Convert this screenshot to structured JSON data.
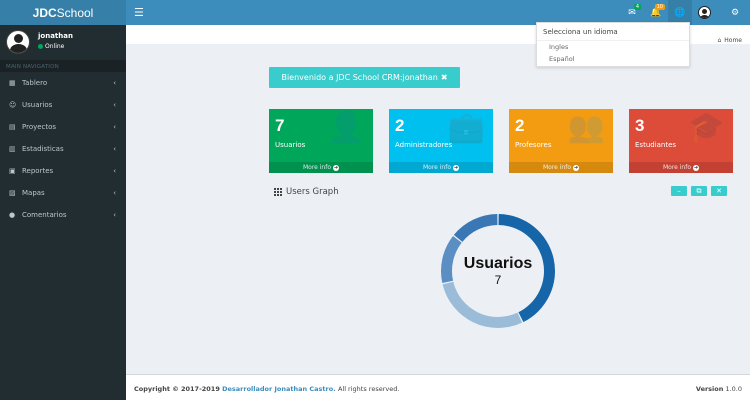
{
  "logo": {
    "bold": "JDC",
    "rest": "School"
  },
  "navbar": {
    "mail_badge": "4",
    "bell_badge": "10"
  },
  "language_dropdown": {
    "header": "Selecciona un idioma",
    "options": [
      "Ingles",
      "Español"
    ]
  },
  "sidebar": {
    "user_name": "jonathan",
    "user_status": "Online",
    "nav_header": "MAIN NAVIGATION",
    "items": [
      {
        "label": "Tablero",
        "icon": "dashboard-icon"
      },
      {
        "label": "Usuarios",
        "icon": "users-icon"
      },
      {
        "label": "Proyectos",
        "icon": "folder-icon"
      },
      {
        "label": "Estadisticas",
        "icon": "chart-icon"
      },
      {
        "label": "Reportes",
        "icon": "report-icon"
      },
      {
        "label": "Mapas",
        "icon": "map-icon"
      },
      {
        "label": "Comentarios",
        "icon": "comment-icon"
      }
    ]
  },
  "breadcrumb": {
    "home": "Home"
  },
  "welcome": {
    "text": "Bienvenido a JDC School CRM:jonathan"
  },
  "boxes": [
    {
      "number": "7",
      "label": "Usuarios",
      "more": "More info",
      "color": "#00a65a",
      "icon": "user-add-icon"
    },
    {
      "number": "2",
      "label": "Administradores",
      "more": "More info",
      "color": "#00c0ef",
      "icon": "briefcase-icon"
    },
    {
      "number": "2",
      "label": "Profesores",
      "more": "More info",
      "color": "#f39c12",
      "icon": "users-group-icon"
    },
    {
      "number": "3",
      "label": "Estudiantes",
      "more": "More info",
      "color": "#dd4b39",
      "icon": "graduation-cap-icon"
    }
  ],
  "graph": {
    "title": "Users Graph",
    "center_title": "Usuarios",
    "center_value": "7"
  },
  "chart_data": {
    "type": "pie",
    "values": [
      3,
      2,
      1,
      1
    ],
    "colors": [
      "#1565a8",
      "#9bbcd8",
      "#5b8ec2",
      "#3a78b5"
    ]
  },
  "footer": {
    "copyright": "Copyright © 2017-2019",
    "author": "Desarrollador Jonathan Castro.",
    "rights": "All rights reserved.",
    "version_label": "Version",
    "version": "1.0.0"
  }
}
